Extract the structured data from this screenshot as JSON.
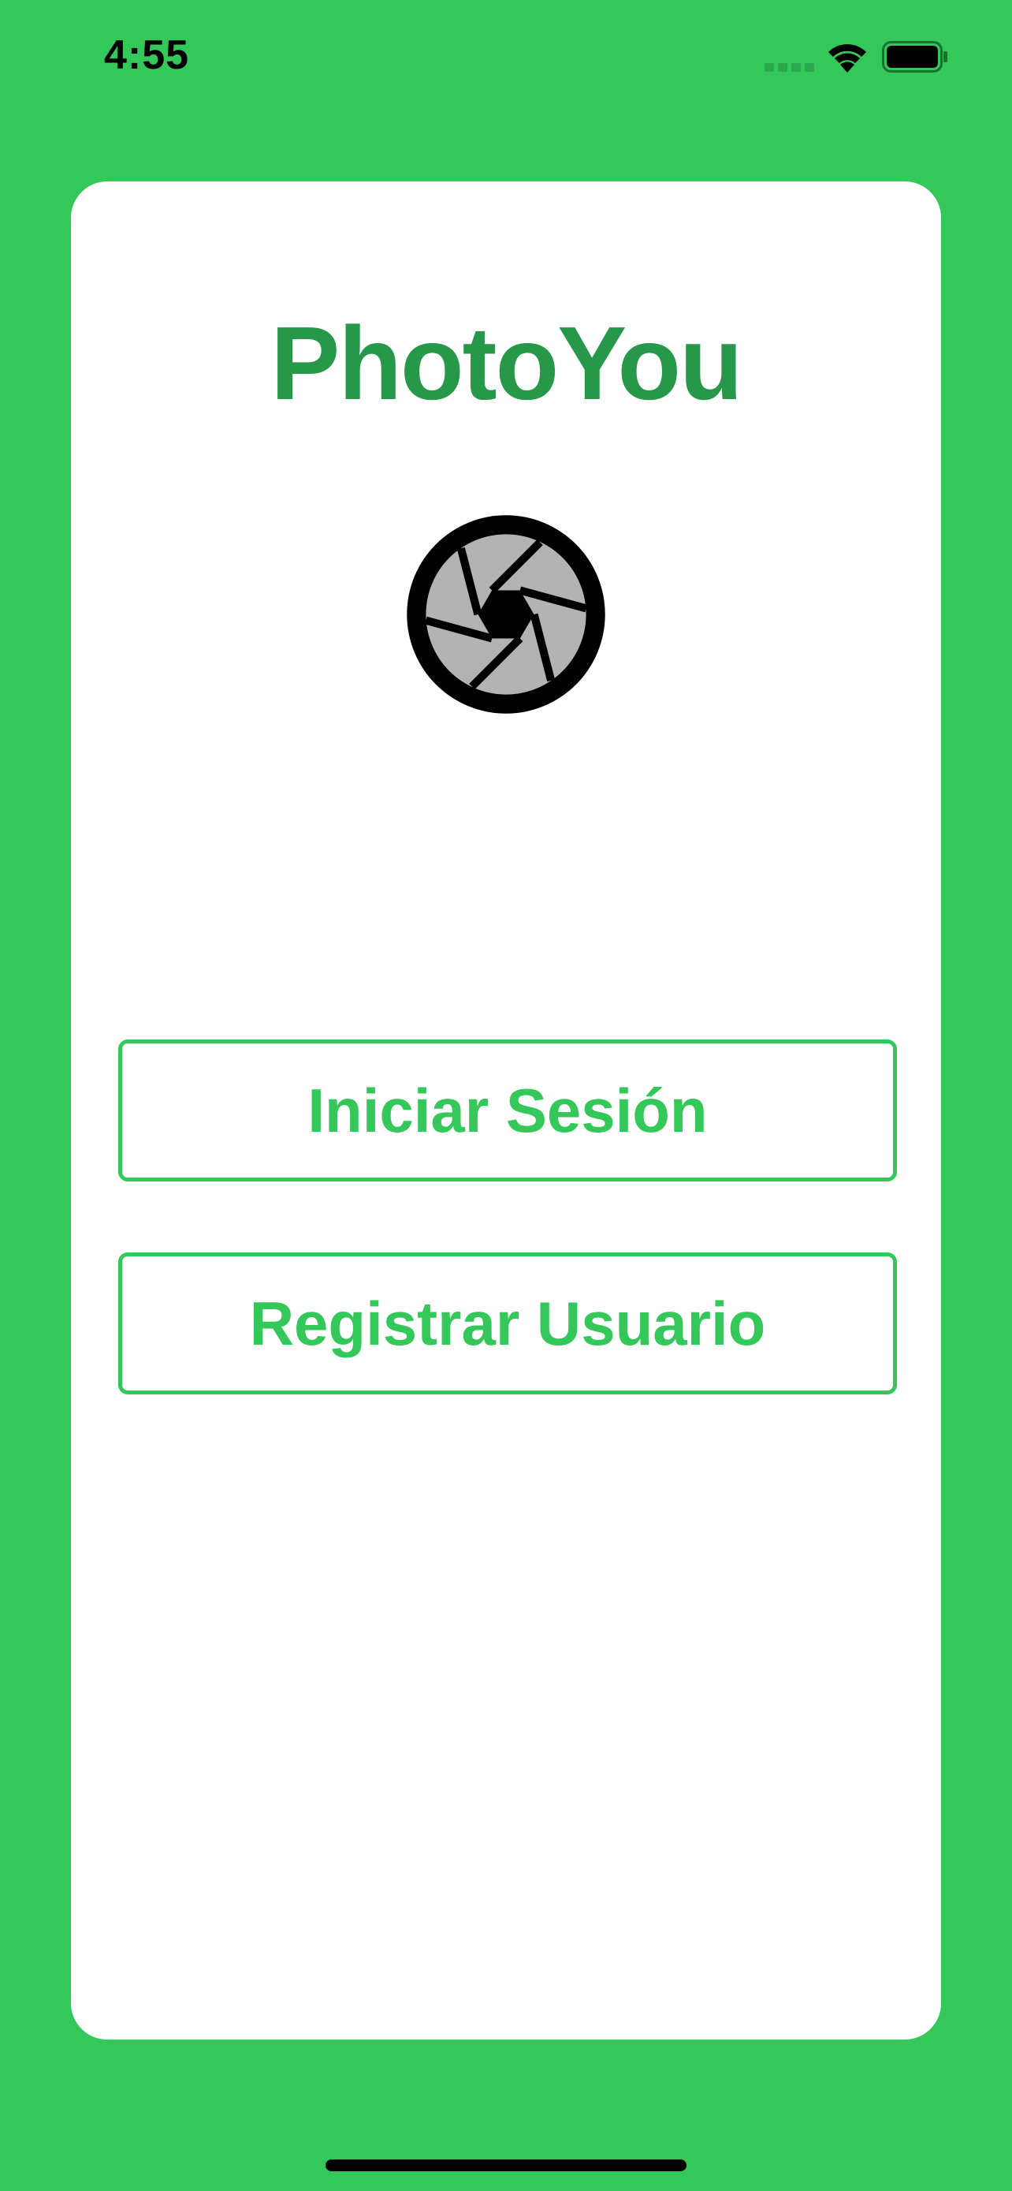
{
  "status_bar": {
    "time": "4:55",
    "icons": [
      "cellular-signal-icon",
      "wifi-icon",
      "battery-icon"
    ]
  },
  "app": {
    "title": "PhotoYou",
    "logo_icon": "camera-aperture-icon"
  },
  "buttons": {
    "login_label": "Iniciar Sesión",
    "register_label": "Registrar Usuario"
  },
  "colors": {
    "background": "#34c759",
    "title": "#27974a",
    "button_accent": "#34c759",
    "card": "#ffffff"
  }
}
